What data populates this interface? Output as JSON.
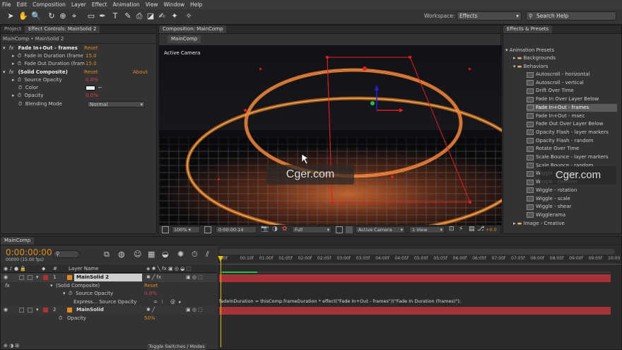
{
  "menu": [
    "File",
    "Edit",
    "Composition",
    "Layer",
    "Effect",
    "Animation",
    "View",
    "Window",
    "Help"
  ],
  "toolbar": {
    "workspace_label": "Workspace:",
    "workspace_value": "Effects",
    "search_placeholder": "Search Help"
  },
  "left_panel": {
    "tabs": [
      "Project",
      "Effect Controls: MainSolid 2"
    ],
    "breadcrumb": "MainComp • MainSolid 2",
    "effect1": {
      "fx": "fx",
      "name": "Fade In+Out - frames",
      "reset": "Reset",
      "props": [
        {
          "label": "Fade In Duration (frame",
          "value": "15.0"
        },
        {
          "label": "Fade Out Duration (fram",
          "value": "15.0"
        }
      ]
    },
    "effect2": {
      "fx": "fx",
      "name": "(Solid Composite)",
      "reset": "Reset",
      "about": "About",
      "props": [
        {
          "label": "Source Opacity",
          "value": "0.0%"
        },
        {
          "label": "Color",
          "value": ""
        },
        {
          "label": "Opacity",
          "value": "0.0%"
        },
        {
          "label": "Blending Mode",
          "value": "Normal"
        }
      ]
    }
  },
  "comp_panel": {
    "tab": "Composition: MainComp",
    "subtab": "MainComp",
    "camera_label": "Active Camera",
    "watermark": "Cger.com",
    "footer": {
      "zoom": "100%",
      "timecode": "0:00:00:14",
      "resolution": "Full",
      "camera": "Active Camera",
      "view": "1 View",
      "offset": "+0.0"
    }
  },
  "right_panel": {
    "tab": "Effects & Presets",
    "tree_root": "Animation Presets",
    "folders": [
      "Backgrounds",
      "Behaviors"
    ],
    "items": [
      "Autoscroll - horizontal",
      "Autoscroll - vertical",
      "Drift Over Time",
      "Fade In Over Layer Below",
      "Fade In+Out - frames",
      "Fade In+Out - msec",
      "Fade Out Over Layer Below",
      "Opacity Flash - layer markers",
      "Opacity Flash - random",
      "Rotate Over Time",
      "Scale Bounce - layer markers",
      "Scale Bounce - random",
      "Wiggle - position",
      "Wiggle - position",
      "Wiggle - rotation",
      "Wiggle - scale",
      "Wiggle - shear",
      "Wigglerama"
    ],
    "last_folder": "Image - Creative",
    "selected_index": 4,
    "watermark": "Cger.com"
  },
  "timeline": {
    "tab": "MainComp",
    "timecode": "0:00:00:00",
    "timecode_sub": "00000 (15.00 fps)",
    "col_header": "Layer Name",
    "col_hash": "#",
    "ruler": [
      "00f",
      "00:10f",
      "01:00f",
      "01:05f",
      "02:00f",
      "02:05f",
      "03:00f",
      "03:05f",
      "04:00f",
      "04:05f",
      "05:00f",
      "05:05f",
      "06:00f",
      "06:05f",
      "07:00f",
      "07:05f",
      "08:00f",
      "08:05f",
      "09:00f",
      "09:05f",
      "10:00"
    ],
    "layers": [
      {
        "num": "1",
        "name": "MainSolid 2",
        "sub": [
          {
            "label": "(Solid Composite)",
            "value": "Reset"
          },
          {
            "label": "Source Opacity",
            "value": "0.0%"
          },
          {
            "label": "Express... Source Opacity",
            "value": ""
          }
        ]
      },
      {
        "num": "2",
        "name": "MainSolid",
        "sub": [
          {
            "label": "Opacity",
            "value": "50%"
          }
        ]
      }
    ],
    "expression": "fadeInDuration = thisComp.frameDuration * effect(\"Fade In+Out - frames\")(\"Fade In Duration (frames)\");",
    "toggle": "Toggle Switches / Modes"
  },
  "colors": {
    "accent": "#e08a1c",
    "layer_bar": "#a8323a",
    "selection_red": "#e02020"
  }
}
